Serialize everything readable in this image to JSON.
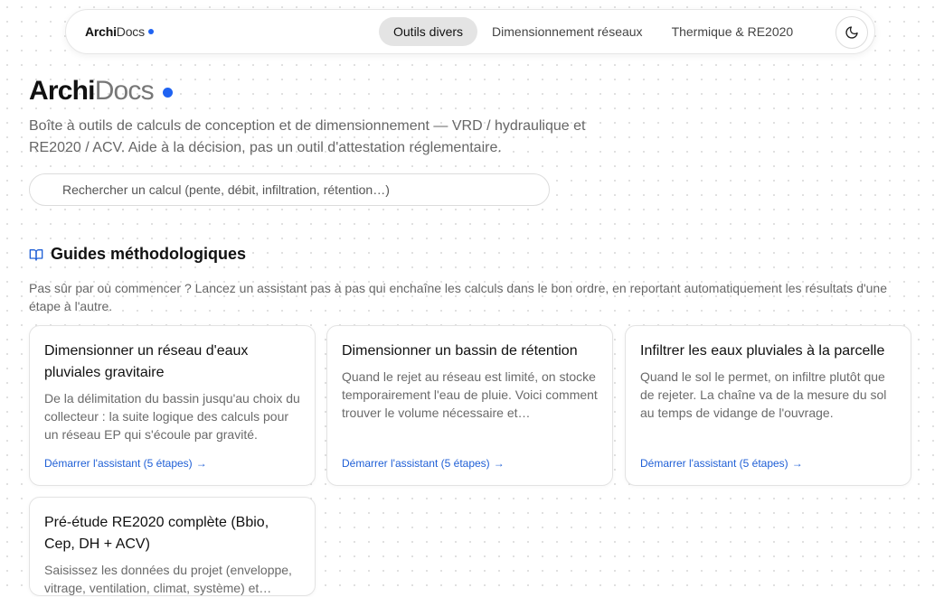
{
  "nav": {
    "brand_a": "Archi",
    "brand_b": "Docs",
    "tabs": [
      {
        "label": "Outils divers",
        "active": true
      },
      {
        "label": "Dimensionnement réseaux",
        "active": false
      },
      {
        "label": "Thermique & RE2020",
        "active": false
      }
    ],
    "theme_icon": "moon-icon"
  },
  "hero": {
    "title_a": "Archi",
    "title_b": "Docs",
    "subtitle": "Boîte à outils de calculs de conception et de dimensionnement — VRD / hydraulique et RE2020 / ACV. Aide à la décision, pas un outil d'attestation réglementaire."
  },
  "search": {
    "placeholder": "Rechercher un calcul (pente, débit, infiltration, rétention…)"
  },
  "guides": {
    "icon": "book-open-icon",
    "title": "Guides méthodologiques",
    "description": "Pas sûr par où commencer ? Lancez un assistant pas à pas qui enchaîne les calculs dans le bon ordre, en reportant automatiquement les résultats d'une étape à l'autre.",
    "cards": [
      {
        "title": "Dimensionner un réseau d'eaux pluviales gravitaire",
        "description": "De la délimitation du bassin jusqu'au choix du collecteur : la suite logique des calculs pour un réseau EP qui s'écoule par gravité.",
        "link": "Démarrer l'assistant (5 étapes)"
      },
      {
        "title": "Dimensionner un bassin de rétention",
        "description": "Quand le rejet au réseau est limité, on stocke temporairement l'eau de pluie. Voici comment trouver le volume nécessaire et…",
        "link": "Démarrer l'assistant (5 étapes)"
      },
      {
        "title": "Infiltrer les eaux pluviales à la parcelle",
        "description": "Quand le sol le permet, on infiltre plutôt que de rejeter. La chaîne va de la mesure du sol au temps de vidange de l'ouvrage.",
        "link": "Démarrer l'assistant (5 étapes)"
      },
      {
        "title": "Pré-étude RE2020 complète (Bbio, Cep, DH + ACV)",
        "description": "Saisissez les données du projet (enveloppe, vitrage, ventilation, climat, système) et…",
        "link": ""
      }
    ]
  },
  "colors": {
    "accent": "#1f63f2",
    "link": "#1f5fd6",
    "active_tab_bg": "#e4e4e4"
  }
}
